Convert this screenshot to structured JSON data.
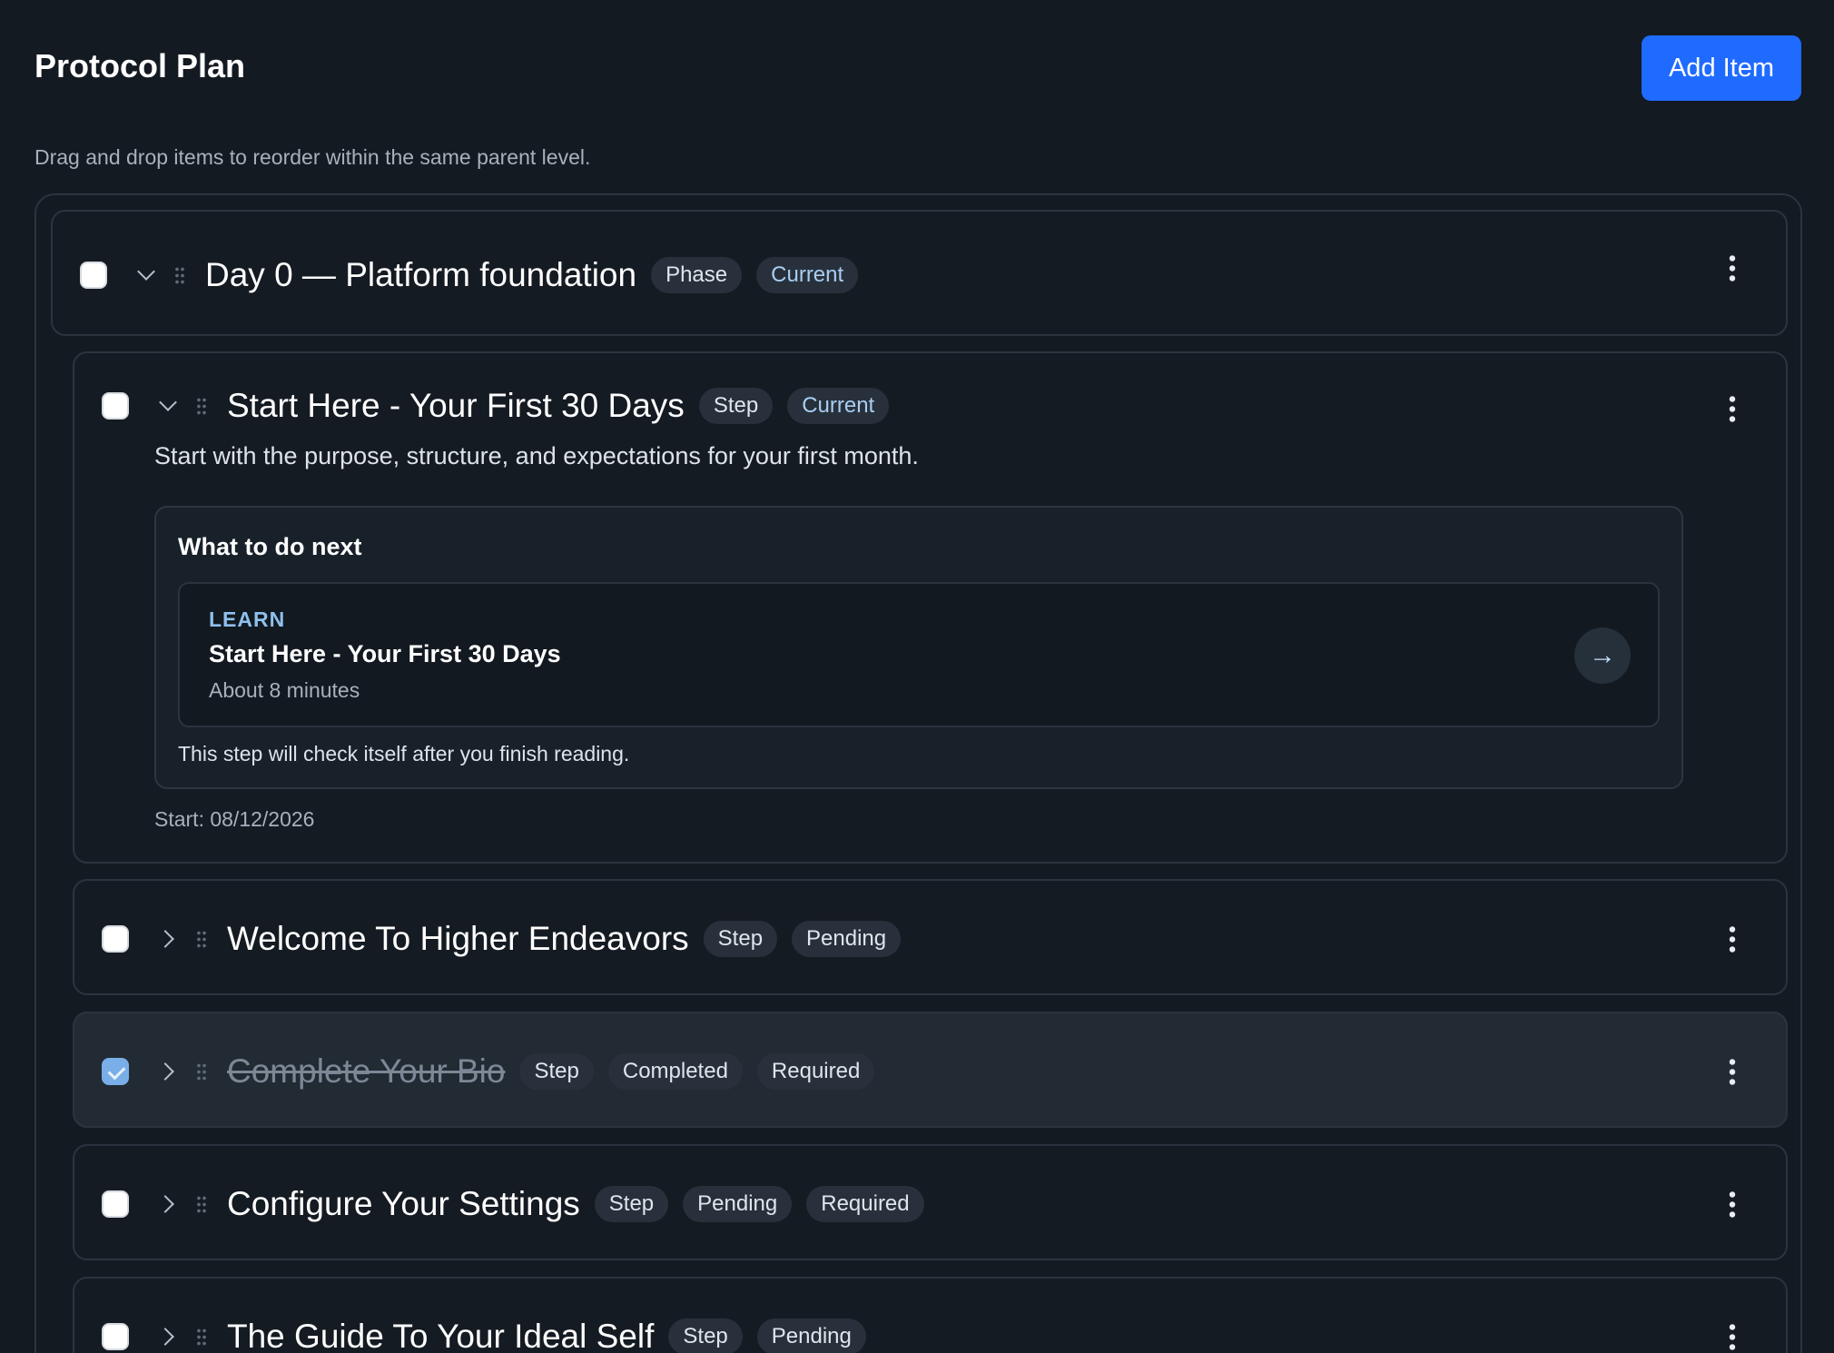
{
  "header": {
    "title": "Protocol Plan",
    "add_button": "Add Item",
    "subtitle": "Drag and drop items to reorder within the same parent level."
  },
  "phase": {
    "title": "Day 0 — Platform foundation",
    "badges": [
      "Phase",
      "Current"
    ]
  },
  "steps": [
    {
      "title": "Start Here - Your First 30 Days",
      "badges": [
        "Step",
        "Current"
      ],
      "description": "Start with the purpose, structure, and expectations for your first month.",
      "next": {
        "heading": "What to do next",
        "kicker": "LEARN",
        "title": "Start Here - Your First 30 Days",
        "duration": "About 8 minutes",
        "note": "This step will check itself after you finish reading."
      },
      "start": "Start: 08/12/2026"
    },
    {
      "title": "Welcome To Higher Endeavors",
      "badges": [
        "Step",
        "Pending"
      ]
    },
    {
      "title": "Complete Your Bio",
      "badges": [
        "Step",
        "Completed",
        "Required"
      ]
    },
    {
      "title": "Configure Your Settings",
      "badges": [
        "Step",
        "Pending",
        "Required"
      ]
    },
    {
      "title": "The Guide To Your Ideal Self",
      "badges": [
        "Step",
        "Pending"
      ]
    }
  ],
  "icons": {
    "arrow": "→"
  }
}
